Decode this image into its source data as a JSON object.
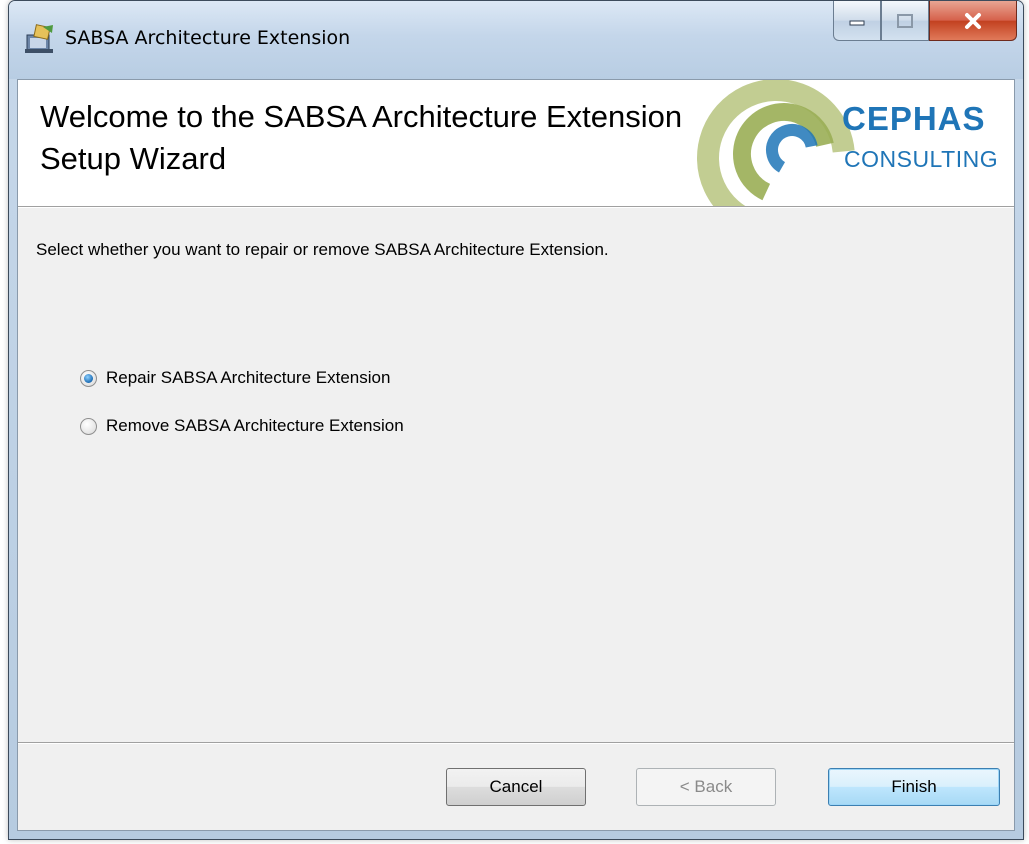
{
  "window": {
    "title": "SABSA Architecture Extension",
    "icon": "installer-icon"
  },
  "caption_buttons": {
    "minimize": "minimize-icon",
    "maximize": "maximize-icon",
    "close": "close-icon"
  },
  "banner": {
    "title_line1": "Welcome to the SABSA Architecture Extension",
    "title_line2": "Setup Wizard",
    "logo_name": "CEPHAS",
    "logo_sub": "CONSULTING",
    "logo_color": "#1f75b7",
    "logo_mark_colors": [
      "#a7b86a",
      "#1f75b7"
    ]
  },
  "instruction": "Select whether you want to repair or remove SABSA Architecture Extension.",
  "options": [
    {
      "label": "Repair SABSA Architecture Extension",
      "selected": true
    },
    {
      "label": "Remove SABSA Architecture Extension",
      "selected": false
    }
  ],
  "buttons": {
    "cancel": "Cancel",
    "back": "< Back",
    "finish": "Finish"
  }
}
